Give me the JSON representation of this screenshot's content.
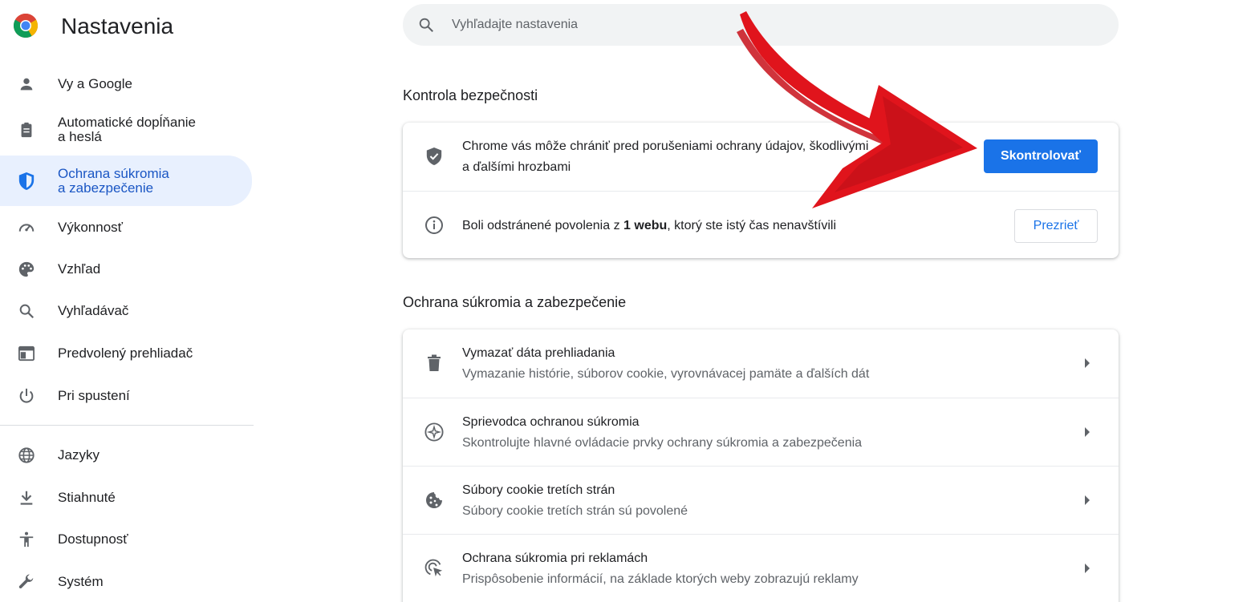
{
  "app": {
    "title": "Nastavenia"
  },
  "search": {
    "placeholder": "Vyhľadajte nastavenia",
    "value": ""
  },
  "sidebar": {
    "items": [
      {
        "label": "Vy a Google",
        "icon": "person-icon"
      },
      {
        "label": "Automatické dopĺňanie\na heslá",
        "icon": "clipboard-icon"
      },
      {
        "label": "Ochrana súkromia\na zabezpečenie",
        "icon": "shield-icon",
        "active": true
      },
      {
        "label": "Výkonnosť",
        "icon": "speedometer-icon"
      },
      {
        "label": "Vzhľad",
        "icon": "palette-icon"
      },
      {
        "label": "Vyhľadávač",
        "icon": "search-icon"
      },
      {
        "label": "Predvolený prehliadač",
        "icon": "browser-icon"
      },
      {
        "label": "Pri spustení",
        "icon": "power-icon"
      },
      {
        "label": "Jazyky",
        "icon": "globe-icon"
      },
      {
        "label": "Stiahnuté",
        "icon": "download-icon"
      },
      {
        "label": "Dostupnosť",
        "icon": "accessibility-icon"
      },
      {
        "label": "Systém",
        "icon": "wrench-icon"
      }
    ]
  },
  "safety": {
    "title": "Kontrola bezpečnosti",
    "check_line1": "Chrome vás môže chrániť pred porušeniami ochrany údajov, škodlivými",
    "check_line2": "a ďalšími hrozbami",
    "check_button": "Skontrolovať",
    "perm_prefix": "Boli odstránené povolenia z ",
    "perm_bold": "1 webu",
    "perm_suffix": ", ktorý ste istý čas nenavštívili",
    "perm_button": "Prezrieť"
  },
  "privacy": {
    "title": "Ochrana súkromia a zabezpečenie",
    "rows": [
      {
        "title": "Vymazať dáta prehliadania",
        "sub": "Vymazanie histórie, súborov cookie, vyrovnávacej pamäte a ďalších dát",
        "icon": "trash-icon"
      },
      {
        "title": "Sprievodca ochranou súkromia",
        "sub": "Skontrolujte hlavné ovládacie prvky ochrany súkromia a zabezpečenia",
        "icon": "compass-icon"
      },
      {
        "title": "Súbory cookie tretích strán",
        "sub": "Súbory cookie tretích strán sú povolené",
        "icon": "cookie-icon"
      },
      {
        "title": "Ochrana súkromia pri reklamách",
        "sub": "Prispôsobenie informácií, na základe ktorých weby zobrazujú reklamy",
        "icon": "ad-target-icon"
      }
    ]
  },
  "colors": {
    "accent": "#1a73e8",
    "active_bg": "#e8f0fe",
    "annotation": "#e0141c"
  }
}
